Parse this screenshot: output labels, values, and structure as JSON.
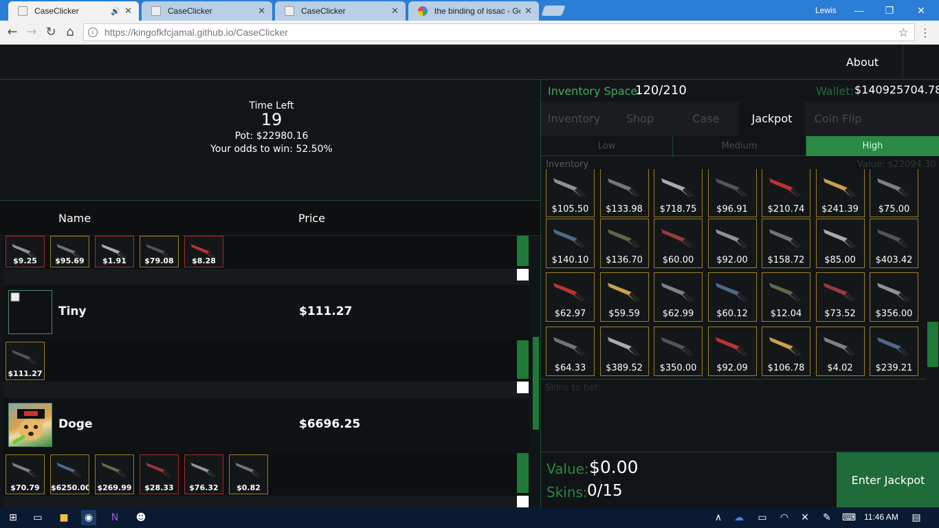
{
  "browser": {
    "tabs": [
      {
        "title": "CaseClicker",
        "active": true,
        "audio": "🔊"
      },
      {
        "title": "CaseClicker"
      },
      {
        "title": "CaseClicker"
      },
      {
        "title": "the binding of issac - Go"
      }
    ],
    "user": "Lewis",
    "url_host": "https://kingofkfcjamal.github.io",
    "url_path": "/CaseClicker"
  },
  "header": {
    "about": "About"
  },
  "jackpot": {
    "time_left_label": "Time Left",
    "time_left": "19",
    "pot": "Pot: $22980.16",
    "odds": "Your odds to win: 52.50%"
  },
  "table": {
    "name_header": "Name",
    "price_header": "Price"
  },
  "players": [
    {
      "name": "",
      "price": "",
      "items": [
        {
          "price": "$9.25",
          "rarity": "red"
        },
        {
          "price": "$95.69",
          "rarity": "gold"
        },
        {
          "price": "$1.91",
          "rarity": "red"
        },
        {
          "price": "$79.08",
          "rarity": "gold"
        },
        {
          "price": "$8.28",
          "rarity": "red"
        }
      ]
    },
    {
      "name": "Tiny",
      "price": "$111.27",
      "items": [
        {
          "price": "$111.27",
          "rarity": "gold"
        }
      ]
    },
    {
      "name": "Doge",
      "price": "$6696.25",
      "items": [
        {
          "price": "$70.79",
          "rarity": "gold"
        },
        {
          "price": "$6250.00",
          "rarity": "gold"
        },
        {
          "price": "$269.99",
          "rarity": "gold"
        },
        {
          "price": "$28.33",
          "rarity": "red"
        },
        {
          "price": "$76.32",
          "rarity": "red"
        },
        {
          "price": "$0.82",
          "rarity": "gold"
        }
      ]
    }
  ],
  "right": {
    "inventory_space_label": "Inventory Space:",
    "inventory_space": "120/210",
    "wallet_label": "Wallet:",
    "wallet": "$140925704.78",
    "tabs": [
      "Inventory",
      "Shop",
      "Case",
      "Jackpot",
      "Coin Flip"
    ],
    "active_tab": "Jackpot",
    "risk": [
      "Low",
      "Medium",
      "High"
    ],
    "active_risk": "High",
    "inventory_label": "Inventory",
    "inventory_value": "Value: $22094.30",
    "grid": [
      "$105.50",
      "$133.98",
      "$718.75",
      "$96.91",
      "$210.74",
      "$241.39",
      "$75.00",
      "$140.10",
      "$136.70",
      "$60.00",
      "$92.00",
      "$158.72",
      "$85.00",
      "$403.42",
      "$62.97",
      "$59.59",
      "$62.99",
      "$60.12",
      "$12.04",
      "$73.52",
      "$356.00",
      "$64.33",
      "$389.52",
      "$350.00",
      "$92.09",
      "$106.78",
      "$4.02",
      "$239.21"
    ],
    "skins_to_bet_label": "Skins to bet:",
    "value_label": "Value:",
    "value": "$0.00",
    "skins_label": "Skins:",
    "skins": "0/15",
    "enter_button": "Enter Jackpot"
  },
  "taskbar": {
    "time": "11:46 AM"
  },
  "colors": {
    "accent": "#2a8a43",
    "gold_border": "#9c7f22",
    "red_border": "#a12b2b"
  }
}
